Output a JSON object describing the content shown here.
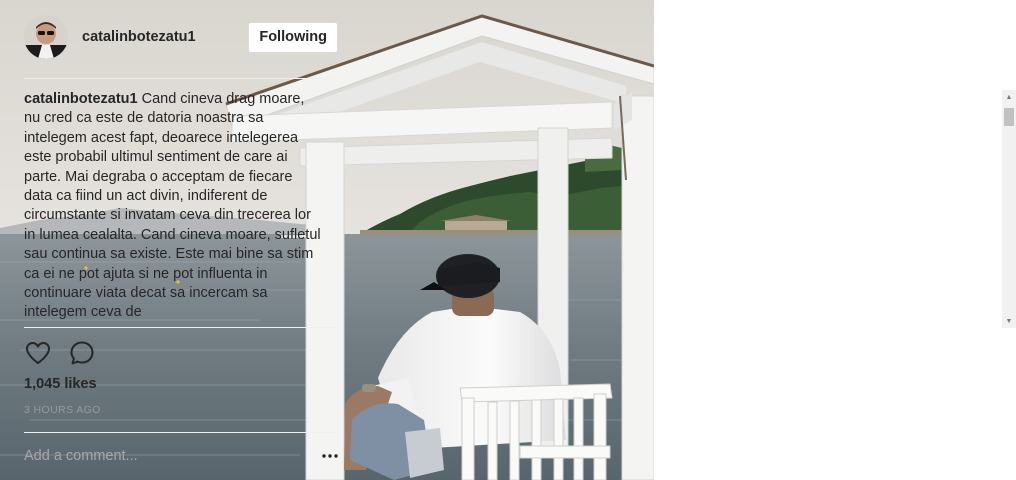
{
  "post": {
    "photo_icon": "post-photo",
    "username": "catalinbotezatu1",
    "follow_label": "Following",
    "caption_user": "catalinbotezatu1",
    "caption_text": "Cand cineva drag moare, nu cred ca este de datoria noastra sa intelegem acest fapt, deoarece intelegerea este probabil ultimul sentiment de care ai parte. Mai degraba o acceptam de fiecare data ca fiind un act divin, indiferent de circumstante si invatam ceva din trecerea lor in lumea cealalta. Cand cineva moare, sufletul sau continua sa existe. Este mai bine sa stim ca ei ne pot ajuta si ne pot influenta in continuare viata decat sa incercam sa intelegem ceva de",
    "likes": "1,045 likes",
    "time": "3 HOURS AGO",
    "comment_placeholder": "Add a comment..."
  },
  "icons": {
    "like": "heart-icon",
    "comment": "comment-bubble-icon",
    "more": "more-options-icon",
    "scroll_up": "scroll-up-arrow-icon",
    "scroll_down": "scroll-down-arrow-icon"
  },
  "colors": {
    "text": "#262626",
    "muted": "#999999",
    "placeholder": "#a8a8a8",
    "divider": "#efefef",
    "button_border": "#dbdbdb"
  }
}
